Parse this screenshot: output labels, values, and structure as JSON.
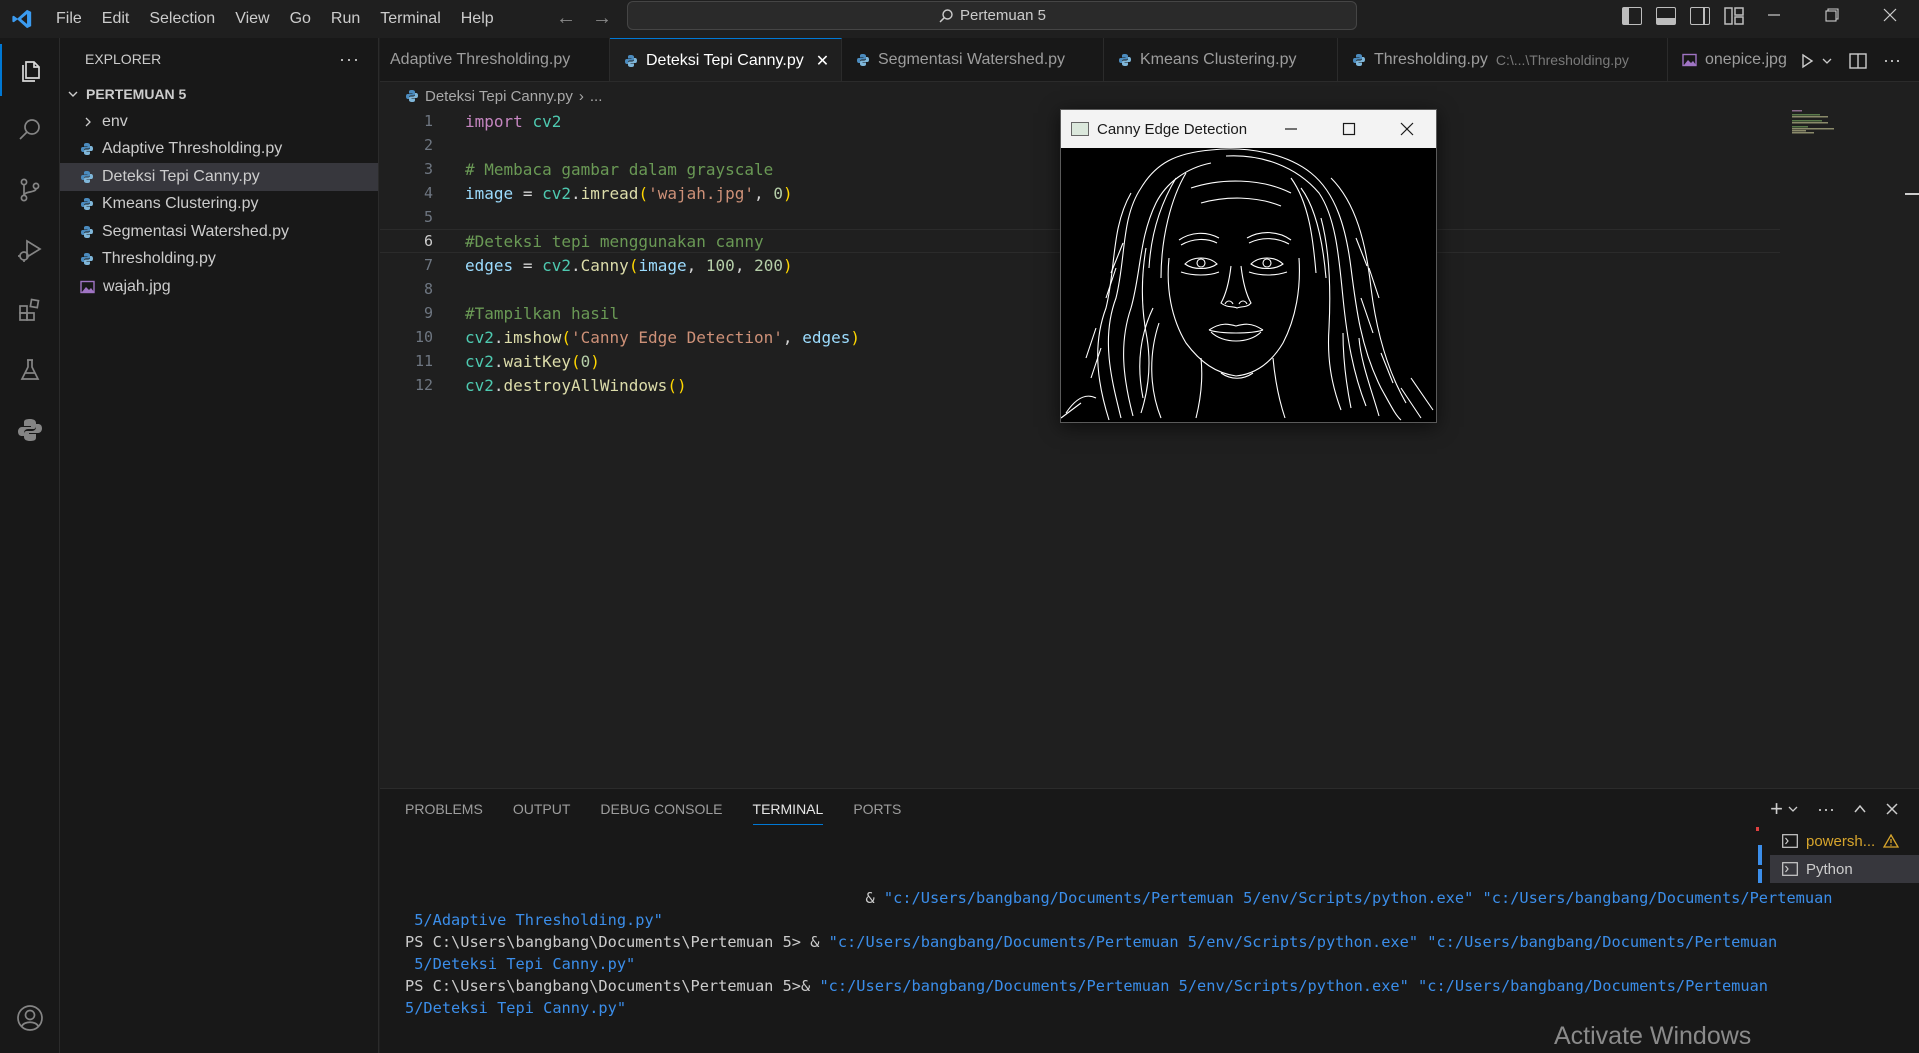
{
  "app": {
    "menu": [
      "File",
      "Edit",
      "Selection",
      "View",
      "Go",
      "Run",
      "Terminal",
      "Help"
    ],
    "command_center": "Pertemuan 5",
    "accent_color": "#0078d4"
  },
  "sidebar": {
    "title": "EXPLORER",
    "folder": "PERTEMUAN 5",
    "items": [
      {
        "label": "env",
        "type": "folder"
      },
      {
        "label": "Adaptive Thresholding.py",
        "type": "python"
      },
      {
        "label": "Deteksi Tepi Canny.py",
        "type": "python"
      },
      {
        "label": "Kmeans Clustering.py",
        "type": "python"
      },
      {
        "label": "Segmentasi Watershed.py",
        "type": "python"
      },
      {
        "label": "Thresholding.py",
        "type": "python"
      },
      {
        "label": "wajah.jpg",
        "type": "image"
      }
    ]
  },
  "tabs": [
    {
      "label": "Adaptive Thresholding.py",
      "desc": ""
    },
    {
      "label": "Deteksi Tepi Canny.py",
      "desc": ""
    },
    {
      "label": "Segmentasi Watershed.py",
      "desc": ""
    },
    {
      "label": "Kmeans Clustering.py",
      "desc": ""
    },
    {
      "label": "Thresholding.py",
      "desc": "C:\\...\\Thresholding.py"
    },
    {
      "label": "onepice.jpg",
      "desc": ""
    }
  ],
  "breadcrumb": {
    "file": "Deteksi Tepi Canny.py",
    "rest": "..."
  },
  "editor": {
    "line_numbers": [
      "1",
      "2",
      "3",
      "4",
      "5",
      "6",
      "7",
      "8",
      "9",
      "10",
      "11",
      "12"
    ],
    "lines": [
      "import cv2",
      "",
      "# Membaca gambar dalam grayscale",
      "image = cv2.imread('wajah.jpg', 0)",
      "",
      "#Deteksi tepi menggunakan canny",
      "edges = cv2.Canny(image, 100, 200)",
      "",
      "#Tampilkan hasil",
      "cv2.imshow('Canny Edge Detection', edges)",
      "cv2.waitKey(0)",
      "cv2.destroyAllWindows()"
    ]
  },
  "canny_window": {
    "title": "Canny Edge Detection"
  },
  "panel": {
    "tabs": [
      "PROBLEMS",
      "OUTPUT",
      "DEBUG CONSOLE",
      "TERMINAL",
      "PORTS"
    ],
    "active_tab": "TERMINAL",
    "terminal_lines": [
      {
        "prompt": "                                                  & ",
        "text": "\"c:/Users/bangbang/Documents/Pertemuan 5/env/Scripts/python.exe\" \"c:/Users/bangbang/Documents/Pertemuan"
      },
      {
        "prompt": " ",
        "text": "5/Adaptive Thresholding.py\""
      },
      {
        "prompt": "PS C:\\Users\\bangbang\\Documents\\Pertemuan 5> & ",
        "text": "\"c:/Users/bangbang/Documents/Pertemuan 5/env/Scripts/python.exe\" \"c:/Users/bangbang/Documents/Pertemuan"
      },
      {
        "prompt": " ",
        "text": "5/Deteksi Tepi Canny.py\""
      },
      {
        "prompt": "PS C:\\Users\\bangbang\\Documents\\Pertemuan 5>& ",
        "text": "\"c:/Users/bangbang/Documents/Pertemuan 5/env/Scripts/python.exe\" \"c:/Users/bangbang/Documents/Pertemuan"
      },
      {
        "prompt": "",
        "text": "5/Deteksi Tepi Canny.py\""
      }
    ],
    "terminals": [
      {
        "label": "powersh...",
        "warn": true
      },
      {
        "label": "Python",
        "warn": false
      }
    ]
  },
  "watermark": "Activate Windows"
}
